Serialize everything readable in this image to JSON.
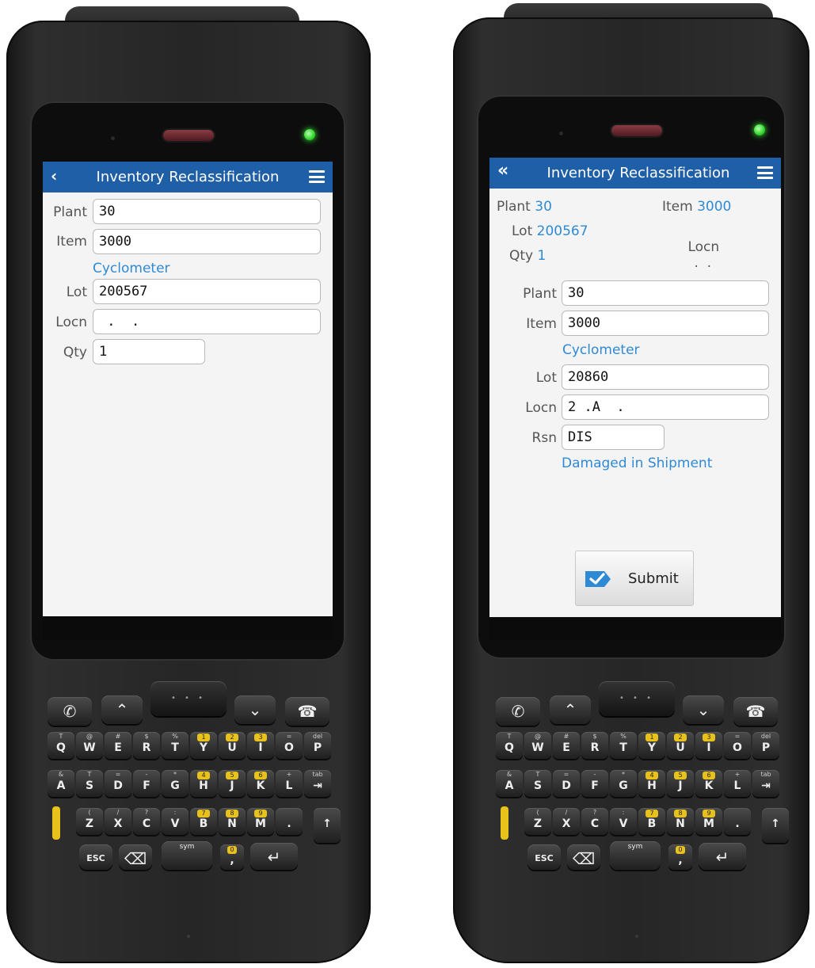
{
  "left": {
    "header": {
      "back_glyph": "‹",
      "title": "Inventory Reclassification"
    },
    "form": {
      "plant_label": "Plant",
      "plant_value": "30",
      "item_label": "Item",
      "item_value": "3000",
      "item_description": "Cyclometer",
      "lot_label": "Lot",
      "lot_value": "200567",
      "locn_label": "Locn",
      "locn_value": " .  .",
      "qty_label": "Qty",
      "qty_value": "1"
    }
  },
  "right": {
    "header": {
      "back_glyph": "«",
      "title": "Inventory Reclassification"
    },
    "summary": {
      "plant_label": "Plant",
      "plant_value": "30",
      "item_label": "Item",
      "item_value": "3000",
      "lot_label": "Lot",
      "lot_value": "200567",
      "locn_label": "Locn",
      "locn_value": ".  .",
      "qty_label": "Qty",
      "qty_value": "1"
    },
    "form": {
      "plant_label": "Plant",
      "plant_value": "30",
      "item_label": "Item",
      "item_value": "3000",
      "item_description": "Cyclometer",
      "lot_label": "Lot",
      "lot_value": "20860",
      "locn_label": "Locn",
      "locn_value": "2 .A  .",
      "rsn_label": "Rsn",
      "rsn_value": "DIS",
      "rsn_description": "Damaged in Shipment"
    },
    "submit_label": "Submit"
  },
  "keypad": {
    "row1": [
      {
        "main": "Q",
        "sub": "T"
      },
      {
        "main": "W",
        "sub": "@"
      },
      {
        "main": "E",
        "sub": "#"
      },
      {
        "main": "R",
        "sub": "$"
      },
      {
        "main": "T",
        "sub": "%"
      },
      {
        "main": "Y",
        "sub": "1",
        "num": true
      },
      {
        "main": "U",
        "sub": "2",
        "num": true
      },
      {
        "main": "I",
        "sub": "3",
        "num": true
      },
      {
        "main": "O",
        "sub": "="
      },
      {
        "main": "P",
        "sub": "del"
      }
    ],
    "row2": [
      {
        "main": "A",
        "sub": "&"
      },
      {
        "main": "S",
        "sub": "T"
      },
      {
        "main": "D",
        "sub": "="
      },
      {
        "main": "F",
        "sub": "-"
      },
      {
        "main": "G",
        "sub": "*"
      },
      {
        "main": "H",
        "sub": "4",
        "num": true
      },
      {
        "main": "J",
        "sub": "5",
        "num": true
      },
      {
        "main": "K",
        "sub": "6",
        "num": true
      },
      {
        "main": "L",
        "sub": "+"
      },
      {
        "main": "⇥",
        "sub": "tab"
      }
    ],
    "row3": [
      {
        "main": "Z",
        "sub": "("
      },
      {
        "main": "X",
        "sub": "/"
      },
      {
        "main": "C",
        "sub": "?"
      },
      {
        "main": "V",
        "sub": ":"
      },
      {
        "main": "B",
        "sub": "7",
        "num": true
      },
      {
        "main": "N",
        "sub": "8",
        "num": true
      },
      {
        "main": "M",
        "sub": "9",
        "num": true
      },
      {
        "main": ".",
        "sub": ""
      }
    ],
    "esc_label": "ESC",
    "backspace_glyph": "⌫",
    "space_label": "sym",
    "comma_sub": "0",
    "comma_main": ",",
    "enter_glyph": "↵",
    "shift_glyph": "↑",
    "call_glyph": "✆",
    "up_glyph": "⌃",
    "down_glyph": "⌄",
    "end_glyph": "☎",
    "center_glyph": "• • •"
  }
}
